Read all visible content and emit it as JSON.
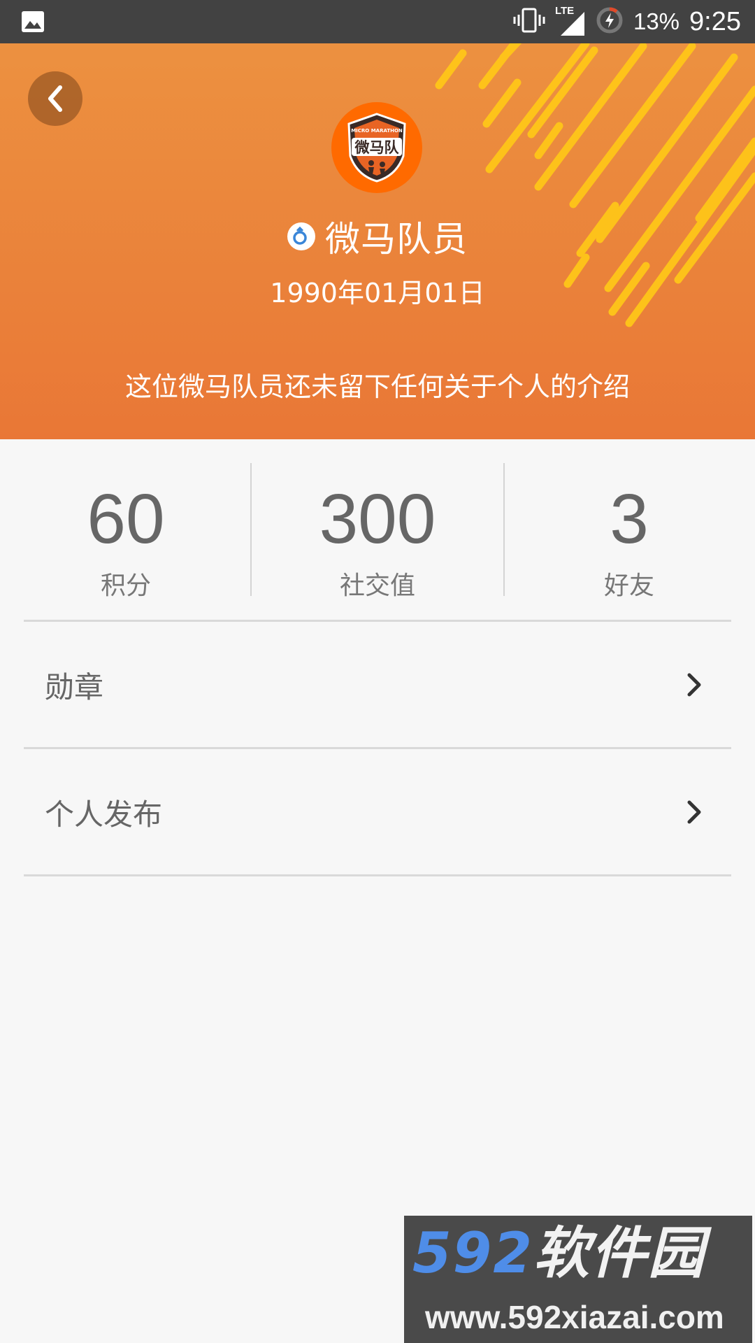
{
  "status_bar": {
    "battery_percent": "13%",
    "time": "9:25",
    "network": "LTE",
    "icons": [
      "image-icon",
      "vibrate-icon",
      "signal-icon",
      "battery-charging-icon"
    ]
  },
  "header": {
    "avatar_text": "微马队",
    "avatar_caption": "MICRO MARATHON",
    "user_name": "微马队员",
    "birthday": "1990年01月01日",
    "bio": "这位微马队员还未留下任何关于个人的介绍",
    "colors": {
      "top": "#ec9140",
      "bottom": "#e97736",
      "stripe": "#ffc619"
    }
  },
  "stats": [
    {
      "value": "60",
      "label": "积分"
    },
    {
      "value": "300",
      "label": "社交值"
    },
    {
      "value": "3",
      "label": "好友"
    }
  ],
  "menu": {
    "items": [
      {
        "label": "勋章"
      },
      {
        "label": "个人发布"
      }
    ]
  },
  "watermark": {
    "brand_num": "592",
    "brand_text": "软件园",
    "url": "www.592xiazai.com"
  }
}
